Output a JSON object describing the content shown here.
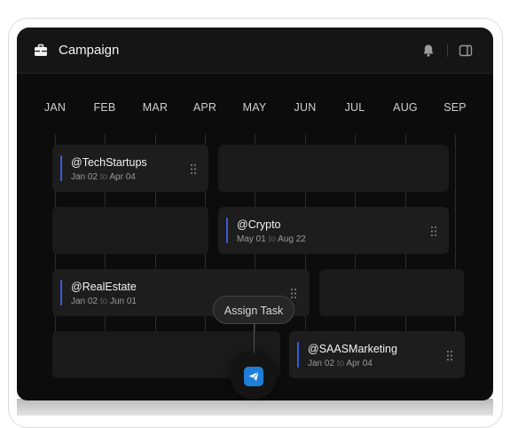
{
  "header": {
    "title": "Campaign",
    "icons": [
      "briefcase-icon",
      "bell-icon",
      "panel-icon"
    ]
  },
  "months": [
    "JAN",
    "FEB",
    "MAR",
    "APR",
    "MAY",
    "JUN",
    "JUL",
    "AUG",
    "SEP"
  ],
  "campaigns": [
    {
      "name": "@TechStartups",
      "start": "Jan 02",
      "to": "to",
      "end": "Apr 04"
    },
    {
      "name": "@Crypto",
      "start": "May 01",
      "to": "to",
      "end": "Aug 22"
    },
    {
      "name": "@RealEstate",
      "start": "Jan 02",
      "to": "to",
      "end": "Jun 01"
    },
    {
      "name": "@SAASMarketing",
      "start": "Jan 02",
      "to": "to",
      "end": "Apr 04"
    }
  ],
  "tooltip": {
    "label": "Assign Task"
  },
  "colors": {
    "accent": "#3b5bd6",
    "fab": "#1f7fd8",
    "background": "#0c0c0c"
  }
}
